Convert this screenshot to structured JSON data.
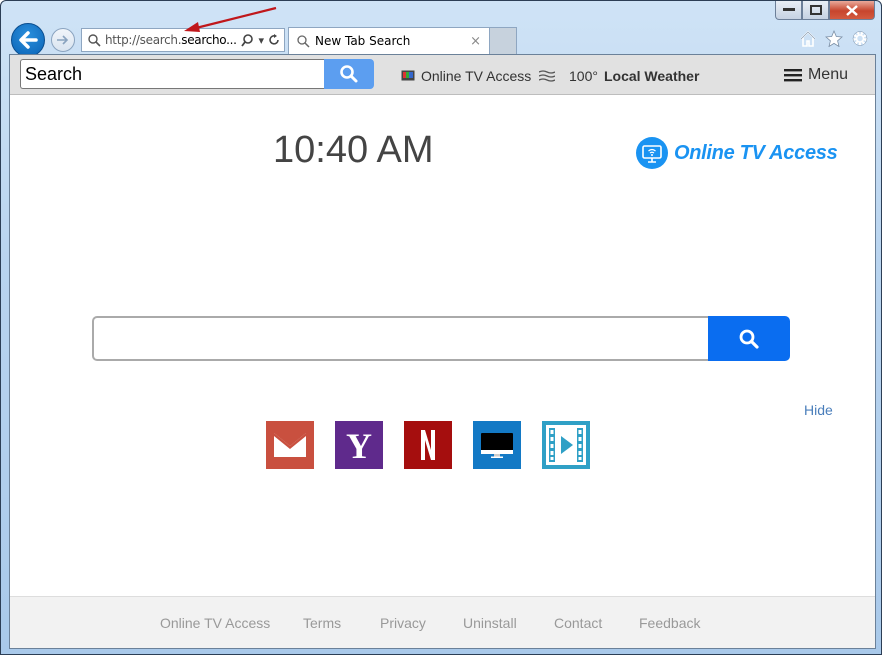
{
  "browser": {
    "address_url_prefix": "http://search.",
    "address_url_domain": "searcho...",
    "tab_title": "New Tab Search",
    "tab_close": "×",
    "icons": [
      "back-icon",
      "forward-icon",
      "search-icon",
      "refresh-icon",
      "home-icon",
      "favorites-star-icon",
      "settings-gear-icon"
    ]
  },
  "toolbar": {
    "search_value": "Search",
    "tv_link": "Online TV Access",
    "weather_temp": "100°",
    "weather_label": "Local Weather",
    "menu_label": "Menu"
  },
  "main": {
    "clock": "10:40 AM",
    "brand": "Online TV Access",
    "search_placeholder": "",
    "hide_label": "Hide",
    "tiles": [
      {
        "name": "gmail",
        "color": "#c9503f"
      },
      {
        "name": "yahoo",
        "color": "#5f2a8c"
      },
      {
        "name": "netflix",
        "color": "#a50e0e"
      },
      {
        "name": "tv",
        "color": "#1379c5"
      },
      {
        "name": "video",
        "color": "#2fa0c6"
      }
    ]
  },
  "footer": {
    "links": [
      "Online TV Access",
      "Terms",
      "Privacy",
      "Uninstall",
      "Contact",
      "Feedback"
    ]
  },
  "colors": {
    "accent": "#0a6df0",
    "toolbar_search": "#5c9ef0",
    "brand": "#1a93f2",
    "annotation_arrow": "#c0171b"
  }
}
